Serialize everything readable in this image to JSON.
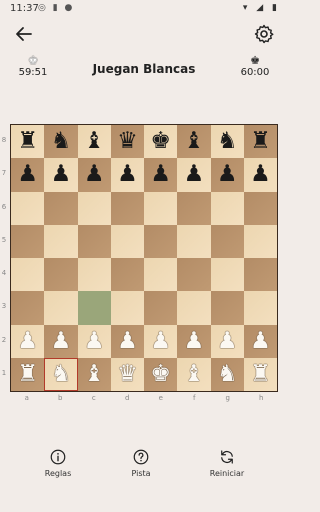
{
  "status_bar": {
    "time": "11:37"
  },
  "header": {
    "turn_label": "Juegan Blancas"
  },
  "timers": {
    "white": {
      "icon": "white-king",
      "value": "59:51"
    },
    "black": {
      "icon": "black-king",
      "value": "60:00"
    }
  },
  "board": {
    "ranks": [
      "8",
      "7",
      "6",
      "5",
      "4",
      "3",
      "2",
      "1"
    ],
    "files": [
      "a",
      "b",
      "c",
      "d",
      "e",
      "f",
      "g",
      "h"
    ],
    "selected_square": "b1",
    "move_hint_square": "c3",
    "position": [
      [
        "♜",
        "♞",
        "♝",
        "♛",
        "♚",
        "♝",
        "♞",
        "♜"
      ],
      [
        "♟",
        "♟",
        "♟",
        "♟",
        "♟",
        "♟",
        "♟",
        "♟"
      ],
      [
        "",
        "",
        "",
        "",
        "",
        "",
        "",
        ""
      ],
      [
        "",
        "",
        "",
        "",
        "",
        "",
        "",
        ""
      ],
      [
        "",
        "",
        "",
        "",
        "",
        "",
        "",
        ""
      ],
      [
        "",
        "",
        "",
        "",
        "",
        "",
        "",
        ""
      ],
      [
        "♟",
        "♟",
        "♟",
        "♟",
        "♟",
        "♟",
        "♟",
        "♟"
      ],
      [
        "♜",
        "♞",
        "♝",
        "♛",
        "♚",
        "♝",
        "♞",
        "♜"
      ]
    ],
    "colors": [
      "black",
      "black",
      "empty",
      "empty",
      "empty",
      "empty",
      "white",
      "white"
    ]
  },
  "bottom_nav": {
    "rules_label": "Reglas",
    "hint_label": "Pista",
    "restart_label": "Reiniciar"
  }
}
